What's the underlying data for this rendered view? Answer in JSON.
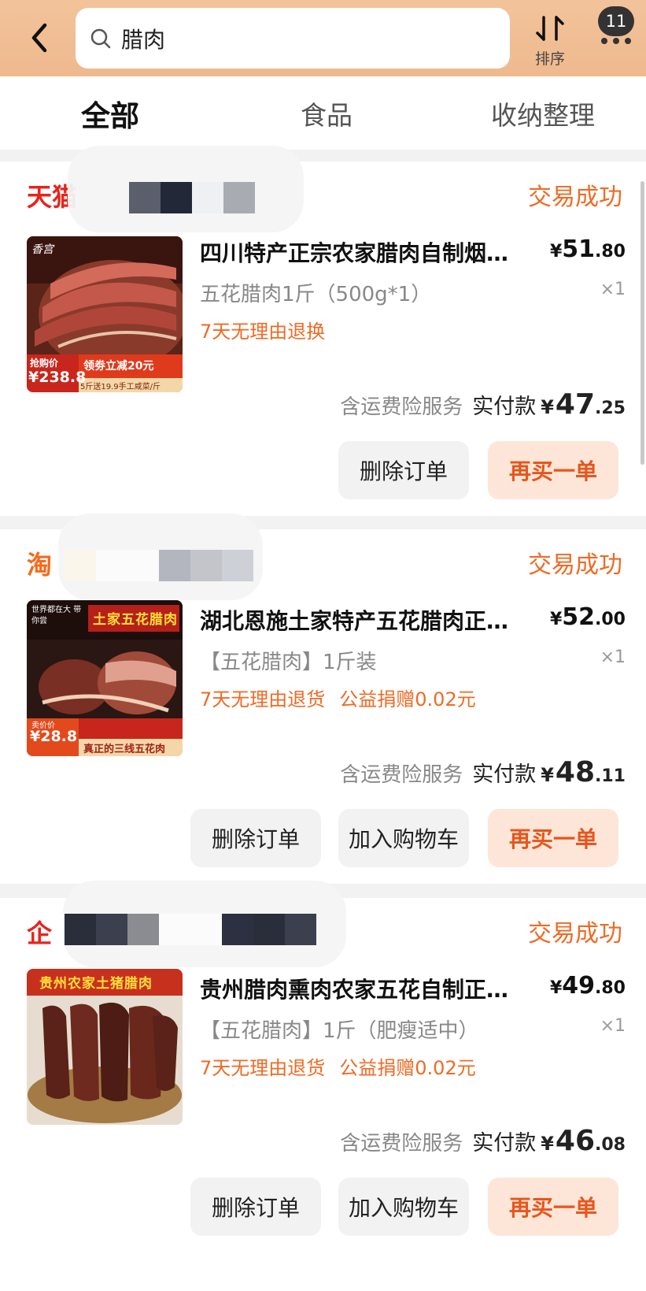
{
  "header": {
    "search_value": "腊肉",
    "sort_label": "排序",
    "more_badge": "11"
  },
  "tabs": [
    {
      "label": "全部",
      "active": true
    },
    {
      "label": "食品",
      "active": false
    },
    {
      "label": "收纳整理",
      "active": false
    }
  ],
  "orders": [
    {
      "shop_logo": "天猫",
      "shop_logo_color": "#e8231c",
      "status": "交易成功",
      "title": "四川特产正宗农家腊肉自制烟…",
      "price": {
        "yen": "¥",
        "int": "51",
        "dec": ".80"
      },
      "spec": "五花腊肉1斤（500g*1）",
      "qty": "×1",
      "tags": [
        "7天无理由退换"
      ],
      "pay_service": "含运费险服务",
      "pay_label": "实付款",
      "pay": {
        "yen": "¥",
        "int": "47",
        "dec": ".25"
      },
      "thumb": {
        "badge_label": "抢购价",
        "badge_price": "¥238.8",
        "promo": "领劵立减20元",
        "promo_sub": "5斤送19.9手工咸菜/斤"
      },
      "buttons": [
        "删除订单",
        "再买一单"
      ]
    },
    {
      "shop_logo": "淘",
      "shop_logo_color": "#f26b1d",
      "status": "交易成功",
      "title": "湖北恩施土家特产五花腊肉正…",
      "price": {
        "yen": "¥",
        "int": "52",
        "dec": ".00"
      },
      "spec": "【五花腊肉】1斤装",
      "qty": "×1",
      "tags": [
        "7天无理由退货",
        "公益捐赠0.02元"
      ],
      "pay_service": "含运费险服务",
      "pay_label": "实付款",
      "pay": {
        "yen": "¥",
        "int": "48",
        "dec": ".11"
      },
      "thumb": {
        "banner": "土家五花腊肉",
        "side_text": "世界都在大 带你尝",
        "badge_price": "¥28.8",
        "badge_label": "卖价价",
        "bottom_text": "真正的三线五花肉"
      },
      "buttons": [
        "删除订单",
        "加入购物车",
        "再买一单"
      ]
    },
    {
      "shop_logo": "企",
      "shop_logo_color": "#e8231c",
      "status": "交易成功",
      "title": "贵州腊肉熏肉农家五花自制正…",
      "price": {
        "yen": "¥",
        "int": "49",
        "dec": ".80"
      },
      "spec": "【五花腊肉】1斤（肥瘦适中）",
      "qty": "×1",
      "tags": [
        "7天无理由退货",
        "公益捐赠0.02元"
      ],
      "pay_service": "含运费险服务",
      "pay_label": "实付款",
      "pay": {
        "yen": "¥",
        "int": "46",
        "dec": ".08"
      },
      "thumb": {
        "banner": "贵州农家土猪腊肉"
      },
      "buttons": [
        "删除订单",
        "加入购物车",
        "再买一单"
      ]
    }
  ]
}
